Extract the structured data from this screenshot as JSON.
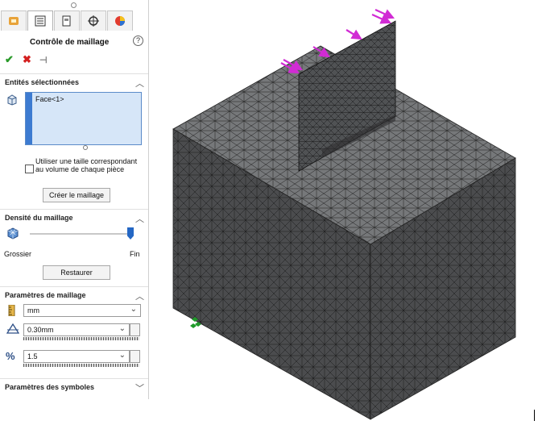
{
  "panel": {
    "title": "Contrôle de maillage",
    "help_icon": "?",
    "tabs": [
      "feature-manager-icon",
      "property-manager-icon",
      "configuration-manager-icon",
      "dimxpert-icon",
      "display-manager-icon"
    ],
    "sections": {
      "entities": {
        "label": "Entités sélectionnées",
        "selected_item": "Face<1>",
        "checkbox_label": "Utiliser une taille correspondant au volume de chaque pièce",
        "create_button": "Créer le maillage"
      },
      "density": {
        "label": "Densité du maillage",
        "min_label": "Grossier",
        "max_label": "Fin",
        "slider_value": 1.0,
        "reset_button": "Restaurer"
      },
      "params": {
        "label": "Paramètres de maillage",
        "unit": "mm",
        "element_size": "0.30mm",
        "ratio": "1.5"
      },
      "symbols": {
        "label": "Paramètres des symboles"
      }
    }
  },
  "colors": {
    "accent": "#3d7bd1",
    "ok": "#2a9a2a",
    "cancel": "#d42020",
    "mesh_top": "#7a7b7c",
    "mesh_side": "#4a4b4c",
    "arrows": "#d12bd4"
  }
}
